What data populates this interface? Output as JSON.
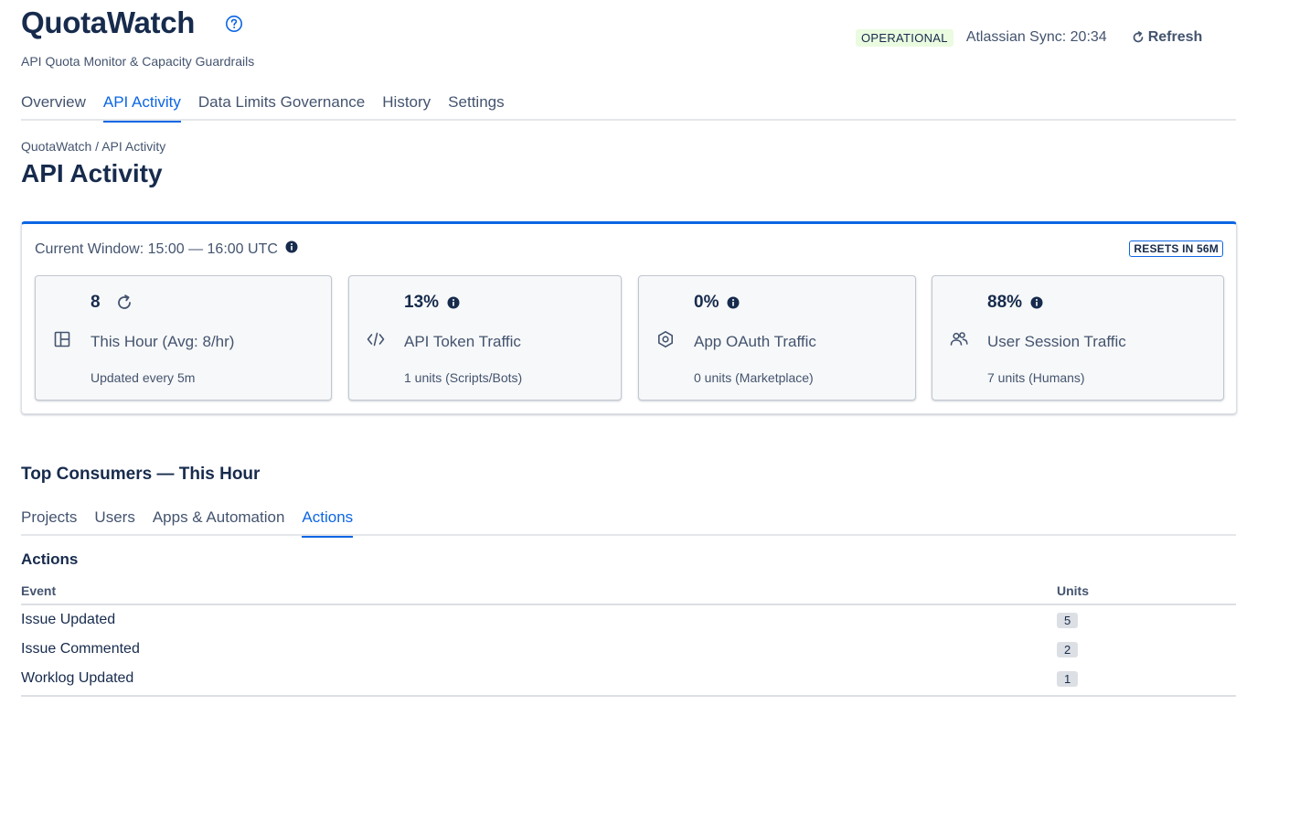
{
  "app": {
    "title": "QuotaWatch",
    "subtitle": "API Quota Monitor & Capacity Guardrails",
    "help_icon": "question-circle-icon"
  },
  "header": {
    "status": "OPERATIONAL",
    "status_color": "#eafbe0",
    "sync_text": "Atlassian Sync: 20:34",
    "refresh_label": "Refresh",
    "refresh_icon": "refresh-icon"
  },
  "nav": {
    "tabs": [
      {
        "label": "Overview",
        "active": false
      },
      {
        "label": "API Activity",
        "active": true
      },
      {
        "label": "Data Limits Governance",
        "active": false
      },
      {
        "label": "History",
        "active": false
      },
      {
        "label": "Settings",
        "active": false
      }
    ]
  },
  "breadcrumb": "QuotaWatch / API Activity",
  "page_title": "API Activity",
  "window": {
    "label": "Current Window: 15:00 — 16:00 UTC",
    "resets": "RESETS IN 56M",
    "accent": "#0c66e4"
  },
  "cards": [
    {
      "value": "8",
      "label": "This Hour (Avg: 8/hr)",
      "sub": "Updated every 5m",
      "icon": "layout-panel-icon",
      "trail_icon": "reload-icon"
    },
    {
      "value": "13%",
      "label": "API Token Traffic",
      "sub": "1 units (Scripts/Bots)",
      "icon": "code-icon",
      "trail_icon": "info-icon"
    },
    {
      "value": "0%",
      "label": "App OAuth Traffic",
      "sub": "0 units (Marketplace)",
      "icon": "hexagon-icon",
      "trail_icon": "info-icon"
    },
    {
      "value": "88%",
      "label": "User Session Traffic",
      "sub": "7 units (Humans)",
      "icon": "users-icon",
      "trail_icon": "info-icon"
    }
  ],
  "consumers": {
    "title": "Top Consumers — This Hour",
    "tabs": [
      {
        "label": "Projects",
        "active": false
      },
      {
        "label": "Users",
        "active": false
      },
      {
        "label": "Apps & Automation",
        "active": false
      },
      {
        "label": "Actions",
        "active": true
      }
    ],
    "table_title": "Actions",
    "columns": [
      "Event",
      "Units"
    ],
    "rows": [
      {
        "event": "Issue Updated",
        "units": "5"
      },
      {
        "event": "Issue Commented",
        "units": "2"
      },
      {
        "event": "Worklog Updated",
        "units": "1"
      }
    ]
  }
}
